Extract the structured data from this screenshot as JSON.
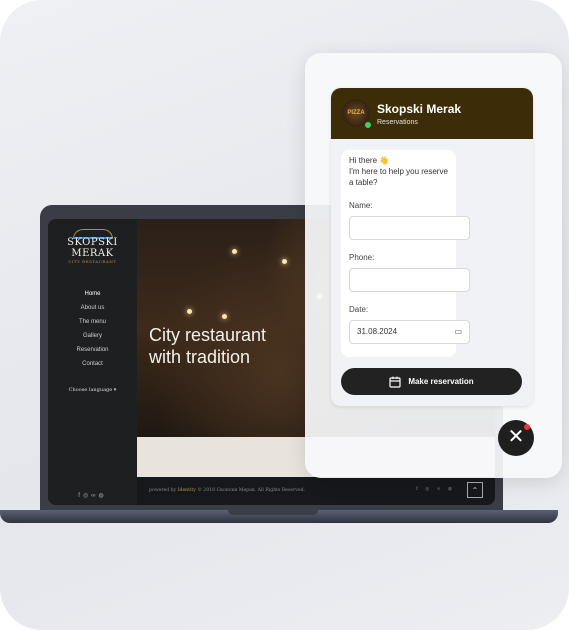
{
  "website": {
    "logo": {
      "name": "SKOPSKI MERAK",
      "tagline": "CITY RESTAURANT",
      "est": "EST. 1923"
    },
    "nav": [
      "Home",
      "About us",
      "The menu",
      "Gallery",
      "Reservation",
      "Contact"
    ],
    "language": "Choose language",
    "hero_title_line1": "City restaurant",
    "hero_title_line2": "with tradition",
    "footer": {
      "prefix": "powered by",
      "brand": "Identity",
      "suffix": "© 2018 Скопски Мерак. All Rights Reserved."
    },
    "social_icons": [
      "facebook-icon",
      "instagram-icon",
      "tripadvisor-icon",
      "web-icon"
    ]
  },
  "chat": {
    "title": "Skopski Merak",
    "subtitle": "Reservations",
    "status_color": "#3bd16f",
    "header_color": "#3d2c08",
    "avatar_text": "PIZZA",
    "greeting": "Hi there 👋",
    "message": "I'm here to help you reserve a table?",
    "fields": {
      "name_label": "Name:",
      "name_value": "",
      "phone_label": "Phone:",
      "phone_value": "",
      "date_label": "Date:",
      "date_value": "31.08.2024"
    },
    "button": "Make reservation"
  }
}
